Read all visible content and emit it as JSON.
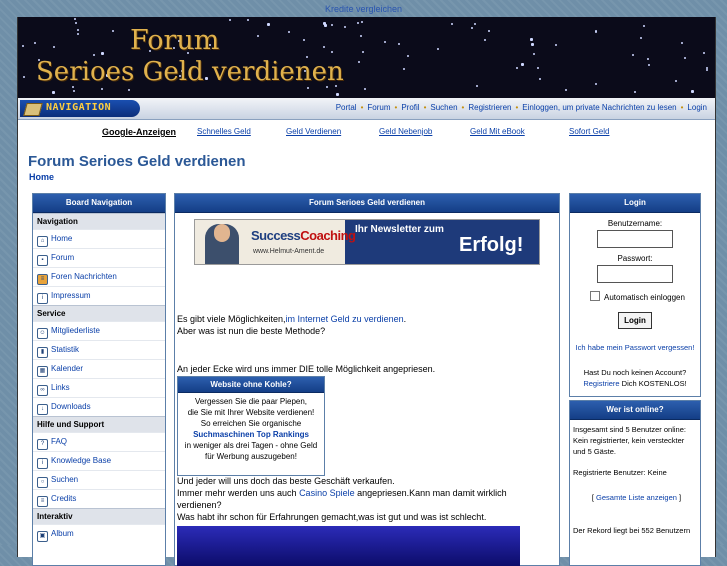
{
  "top_link": "Kredite vergleichen",
  "banner": {
    "line1": "Forum",
    "line2": "Serioes Geld verdienen"
  },
  "nav": {
    "badge_text": "NAVIGATION",
    "links": [
      "Portal",
      "Forum",
      "Profil",
      "Suchen",
      "Registrieren",
      "Einloggen, um private Nachrichten zu lesen",
      "Login"
    ]
  },
  "ads": {
    "label": "Google-Anzeigen",
    "links": [
      "Schnelles Geld",
      "Geld Verdienen",
      "Geld Nebenjob",
      "Geld Mit eBook",
      "Sofort Geld"
    ]
  },
  "page_title": "Forum Serioes Geld verdienen",
  "breadcrumb_home": "Home",
  "left": {
    "title": "Board Navigation",
    "sections": [
      {
        "name": "Navigation",
        "items": [
          "Home",
          "Forum",
          "Foren Nachrichten",
          "Impressum"
        ]
      },
      {
        "name": "Service",
        "items": [
          "Mitgliederliste",
          "Statistik",
          "Kalender",
          "Links",
          "Downloads"
        ]
      },
      {
        "name": "Hilfe und Support",
        "items": [
          "FAQ",
          "Knowledge Base",
          "Suchen",
          "Credits"
        ]
      },
      {
        "name": "Interaktiv",
        "items": [
          "Album"
        ]
      }
    ]
  },
  "center": {
    "title": "Forum Serioes Geld verdienen",
    "ad": {
      "brand1": "Success",
      "brand2": "Coaching",
      "url": "www.Helmut-Ament.de",
      "news": "Ihr Newsletter zum",
      "erfolg": "Erfolg!"
    },
    "p1_pre": "Es gibt viele Möglichkeiten,",
    "p1_link": "im Internet Geld zu verdienen",
    "p1_post": ".",
    "p2": "Aber was ist nun die beste Methode?",
    "p3": "An jeder Ecke wird uns immer DIE tolle Möglichkeit angepriesen.",
    "web_box": {
      "title": "Website ohne Kohle?",
      "l1": "Vergessen Sie die paar Piepen,",
      "l2": "die Sie mit Ihrer Website verdienen!",
      "l3": "So erreichen Sie organische",
      "l4": "Suchmaschinen Top Rankings",
      "l5": "in weniger als drei Tagen - ohne Geld",
      "l6": "für Werbung auszugeben!"
    },
    "p4": "Und jeder will uns doch das beste Geschäft verkaufen.",
    "p5_pre": "Immer mehr werden uns auch ",
    "p5_link": "Casino Spiele",
    "p5_post": " angepriesen.Kann man damit wirklich",
    "p6": "verdienen?",
    "p7": "Was habt ihr schon für Erfahrungen gemacht,was ist gut und was ist schlecht."
  },
  "login": {
    "title": "Login",
    "user_label": "Benutzername:",
    "pass_label": "Passwort:",
    "auto_label": "Automatisch einloggen",
    "button": "Login",
    "forgot": "Ich habe mein Passwort vergessen!",
    "no_account": "Hast Du noch keinen Account?",
    "register": "Registriere",
    "register_post": " Dich KOSTENLOS!"
  },
  "online": {
    "title": "Wer ist online?",
    "l1": "Insgesamt sind 5 Benutzer online:",
    "l2": "Kein registrierter, kein versteckter",
    "l3": "und 5 Gäste.",
    "l4": "Registrierte Benutzer: Keine",
    "list_link": "Gesamte Liste anzeigen",
    "record": "Der Rekord liegt bei 552 Benutzern"
  }
}
